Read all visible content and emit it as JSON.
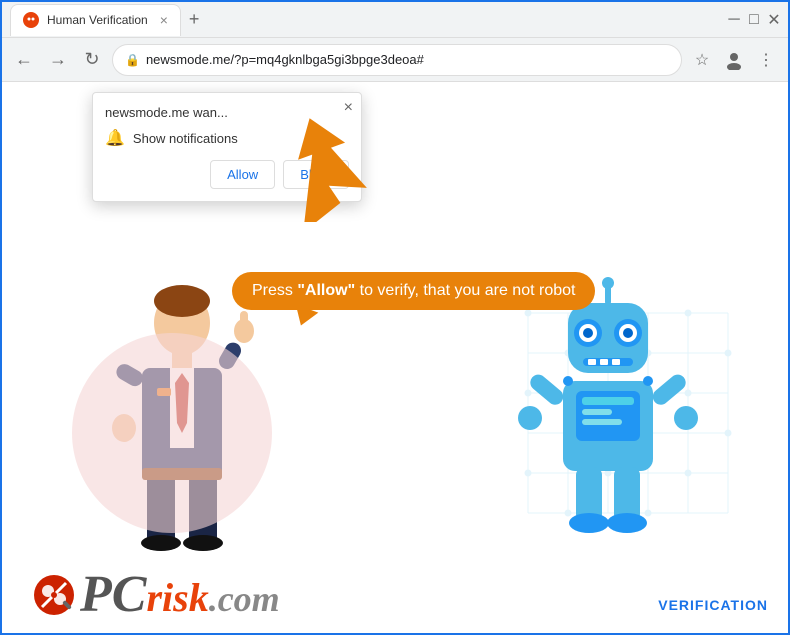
{
  "browser": {
    "tab_title": "Human Verification",
    "url": "newsmode.me/?p=mq4gknlbga5gi3bpge3deoa#"
  },
  "popup": {
    "title": "newsmode.me wan...",
    "notification_label": "Show notifications",
    "allow_button": "Allow",
    "block_button": "Block",
    "close_label": "×"
  },
  "speech_bubble": {
    "text_before": "Press ",
    "highlighted": "\"Allow\"",
    "text_after": " to verify, that you are not robot"
  },
  "footer": {
    "brand_pc": "PC",
    "brand_risk": "risk",
    "brand_dotcom": ".com",
    "verification": "VERIFICATION"
  },
  "icons": {
    "back": "←",
    "forward": "→",
    "refresh": "↻",
    "lock": "🔒",
    "star": "☆",
    "user": "👤",
    "menu": "⋮",
    "bell": "🔔",
    "close": "×",
    "new_tab": "+"
  }
}
